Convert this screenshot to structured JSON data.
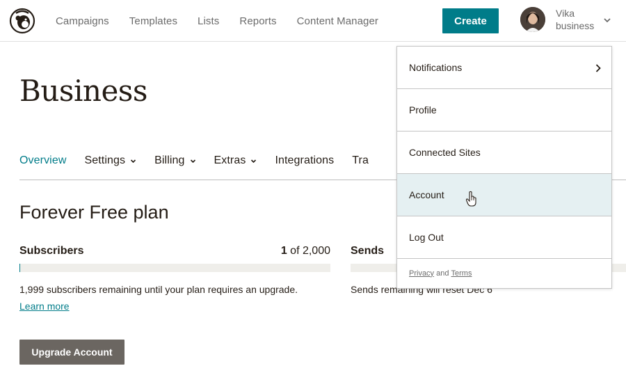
{
  "nav": {
    "logo": "mailchimp-freddie-logo",
    "links": [
      "Campaigns",
      "Templates",
      "Lists",
      "Reports",
      "Content Manager"
    ],
    "create_label": "Create",
    "user": {
      "name": "Vika",
      "account": "business"
    }
  },
  "page": {
    "title": "Business",
    "tabs": [
      {
        "label": "Overview",
        "has_chevron": false,
        "active": true
      },
      {
        "label": "Settings",
        "has_chevron": true
      },
      {
        "label": "Billing",
        "has_chevron": true
      },
      {
        "label": "Extras",
        "has_chevron": true
      },
      {
        "label": "Integrations",
        "has_chevron": false
      },
      {
        "label": "Tra",
        "has_chevron": false
      }
    ],
    "plan_title": "Forever Free plan",
    "subscribers": {
      "label": "Subscribers",
      "count_current": "1",
      "count_text": " of 2,000",
      "used_fraction": 0.0005,
      "note": "1,999 subscribers remaining until your plan requires an upgrade.",
      "learn_more": "Learn more"
    },
    "sends": {
      "label": "Sends",
      "note": "Sends remaining will reset Dec 6"
    },
    "upgrade_label": "Upgrade Account"
  },
  "dropdown": {
    "items": [
      {
        "label": "Notifications",
        "has_arrow": true
      },
      {
        "label": "Profile"
      },
      {
        "label": "Connected Sites"
      },
      {
        "label": "Account",
        "hovered": true
      },
      {
        "label": "Log Out"
      }
    ],
    "footer": {
      "privacy": "Privacy",
      "and": " and ",
      "terms": "Terms"
    }
  },
  "colors": {
    "accent": "#007c89",
    "text": "#241c15",
    "muted": "#6b6b6b",
    "hover_bg": "#e5f0f2",
    "upgrade_bg": "#6b6661",
    "bar_bg": "#efeeea"
  }
}
